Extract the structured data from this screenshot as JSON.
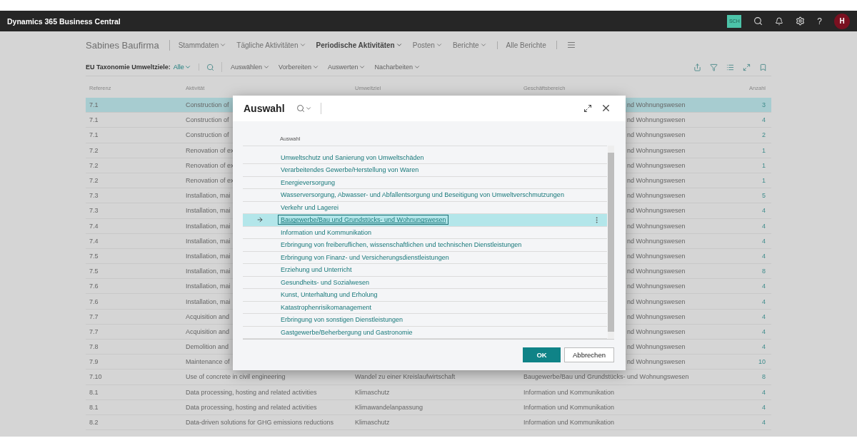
{
  "app_bar": {
    "title": "Dynamics 365 Business Central",
    "badge": "SCH",
    "help": "?",
    "avatar": "H"
  },
  "nav": {
    "company": "Sabines Baufirma",
    "menus": [
      {
        "label": "Stammdaten",
        "dropdown": true,
        "selected": false
      },
      {
        "label": "Tägliche Aktivitäten",
        "dropdown": true,
        "selected": false
      },
      {
        "label": "Periodische Aktivitäten",
        "dropdown": true,
        "selected": true
      },
      {
        "label": "Posten",
        "dropdown": true,
        "selected": false
      },
      {
        "label": "Berichte",
        "dropdown": true,
        "selected": false
      },
      {
        "label": "Alle Berichte",
        "dropdown": false,
        "selected": false
      }
    ]
  },
  "action_bar": {
    "filter_label": "EU Taxonomie Umweltziele:",
    "filter_value": "Alle",
    "actions": [
      "Auswählen",
      "Vorbereiten",
      "Auswerten",
      "Nacharbeiten"
    ]
  },
  "table": {
    "columns": [
      "Referenz",
      "Aktivität",
      "Umweltziel",
      "Geschäftsbereich",
      "Anzahl"
    ],
    "rows": [
      {
        "reference": "7.1",
        "activity": "Construction of",
        "business_area": "nd Wohnungswesen",
        "count": "3",
        "selected": true
      },
      {
        "reference": "7.1",
        "activity": "Construction of",
        "business_area": "nd Wohnungswesen",
        "count": "4",
        "selected": false
      },
      {
        "reference": "7.1",
        "activity": "Construction of",
        "business_area": "nd Wohnungswesen",
        "count": "2",
        "selected": false
      },
      {
        "reference": "7.2",
        "activity": "Renovation of ex",
        "business_area": "nd Wohnungswesen",
        "count": "1",
        "selected": false
      },
      {
        "reference": "7.2",
        "activity": "Renovation of ex",
        "business_area": "nd Wohnungswesen",
        "count": "1",
        "selected": false
      },
      {
        "reference": "7.2",
        "activity": "Renovation of ex",
        "business_area": "nd Wohnungswesen",
        "count": "1",
        "selected": false
      },
      {
        "reference": "7.3",
        "activity": "Installation, mai",
        "business_area": "nd Wohnungswesen",
        "count": "5",
        "selected": false
      },
      {
        "reference": "7.3",
        "activity": "Installation, mai",
        "business_area": "nd Wohnungswesen",
        "count": "4",
        "selected": false
      },
      {
        "reference": "7.4",
        "activity": "Installation, mai",
        "business_area": "nd Wohnungswesen",
        "count": "4",
        "selected": false
      },
      {
        "reference": "7.4",
        "activity": "Installation, mai",
        "business_area": "nd Wohnungswesen",
        "count": "4",
        "selected": false
      },
      {
        "reference": "7.5",
        "activity": "Installation, mai",
        "business_area": "nd Wohnungswesen",
        "count": "4",
        "selected": false
      },
      {
        "reference": "7.5",
        "activity": "Installation, mai",
        "business_area": "nd Wohnungswesen",
        "count": "8",
        "selected": false
      },
      {
        "reference": "7.6",
        "activity": "Installation, mai",
        "business_area": "nd Wohnungswesen",
        "count": "4",
        "selected": false
      },
      {
        "reference": "7.6",
        "activity": "Installation, mai",
        "business_area": "nd Wohnungswesen",
        "count": "4",
        "selected": false
      },
      {
        "reference": "7.7",
        "activity": "Acquisition and",
        "business_area": "nd Wohnungswesen",
        "count": "4",
        "selected": false
      },
      {
        "reference": "7.7",
        "activity": "Acquisition and",
        "business_area": "nd Wohnungswesen",
        "count": "4",
        "selected": false
      },
      {
        "reference": "7.8",
        "activity": "Demolition and",
        "business_area": "nd Wohnungswesen",
        "count": "4",
        "selected": false
      },
      {
        "reference": "7.9",
        "activity": "Maintenance of",
        "business_area": "nd Wohnungswesen",
        "count": "10",
        "selected": false
      },
      {
        "reference": "7.10",
        "activity": "Use of concrete in civil engineering",
        "goal": "Wandel zu einer Kreislaufwirtschaft",
        "business_area": "Baugewerbe/Bau und Grundstücks- und Wohnungswesen",
        "count": "8",
        "selected": false
      },
      {
        "reference": "8.1",
        "activity": "Data processing, hosting and related activities",
        "goal": "Klimaschutz",
        "business_area": "Information und Kommunikation",
        "count": "4",
        "selected": false
      },
      {
        "reference": "8.1",
        "activity": "Data processing, hosting and related activities",
        "goal": "Klimawandelanpassung",
        "business_area": "Information und Kommunikation",
        "count": "4",
        "selected": false
      },
      {
        "reference": "8.2",
        "activity": "Data-driven solutions for GHG emissions reductions",
        "goal": "Klimaschutz",
        "business_area": "Information und Kommunikation",
        "count": "4",
        "selected": false
      }
    ]
  },
  "dialog": {
    "title": "Auswahl",
    "column": "Auswahl",
    "items": [
      {
        "label": "Umweltschutz und Sanierung von Umweltschäden",
        "selected": false
      },
      {
        "label": "Verarbeitendes Gewerbe/Herstellung von Waren",
        "selected": false
      },
      {
        "label": "Energieversorgung",
        "selected": false
      },
      {
        "label": "Wasserversorgung, Abwasser- und Abfallentsorgung und Beseitigung von Umweltverschmutzungen",
        "selected": false
      },
      {
        "label": "Verkehr und Lagerei",
        "selected": false
      },
      {
        "label": "Baugewerbe/Bau und Grundstücks- und Wohnungswesen",
        "selected": true
      },
      {
        "label": "Information und Kommunikation",
        "selected": false
      },
      {
        "label": "Erbringung von freiberuflichen, wissenschaftlichen und technischen Dienstleistungen",
        "selected": false
      },
      {
        "label": "Erbringung von Finanz- und Versicherungsdienstleistungen",
        "selected": false
      },
      {
        "label": "Erziehung und Unterricht",
        "selected": false
      },
      {
        "label": "Gesundheits- und Sozialwesen",
        "selected": false
      },
      {
        "label": "Kunst, Unterhaltung und Erholung",
        "selected": false
      },
      {
        "label": "Katastrophenrisikomanagement",
        "selected": false
      },
      {
        "label": "Erbringung von sonstigen Dienstleistungen",
        "selected": false
      },
      {
        "label": "Gastgewerbe/Beherbergung und Gastronomie",
        "selected": false
      }
    ],
    "buttons": [
      {
        "label": "OK",
        "kind": "primary"
      },
      {
        "label": "Abbrechen",
        "kind": "secondary"
      }
    ]
  }
}
